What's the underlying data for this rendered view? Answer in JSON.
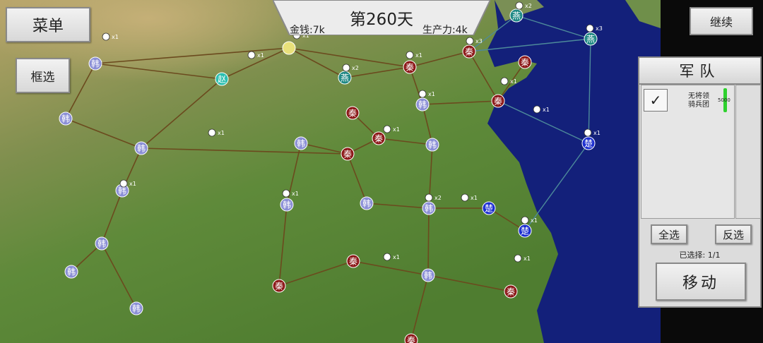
{
  "buttons": {
    "menu": "菜单",
    "box_select": "框选",
    "continue": "继续"
  },
  "banner": {
    "day": "第260天",
    "money": "金钱:7k",
    "production": "生产力:4k"
  },
  "army_panel": {
    "title": "军队",
    "unit": {
      "general": "无将领",
      "type": "骑兵团",
      "count": "5000",
      "checked": "✓"
    },
    "select_all": "全选",
    "invert": "反选",
    "selected": "已选择: 1/1",
    "move": "移动"
  },
  "colors": {
    "qin": "#8c1818",
    "han": "#8b8fd6",
    "zhao": "#2bbfb0",
    "yan": "#1e8884",
    "chu": "#1d2fd0",
    "neutral": "#e8e07a",
    "road": "#6b4a1e",
    "sea": "#13207a"
  },
  "map": {
    "cities": [
      {
        "name": "韩",
        "faction": "han"
      },
      {
        "name": "韩",
        "faction": "han"
      },
      {
        "name": "韩",
        "faction": "han"
      },
      {
        "name": "韩",
        "faction": "han"
      },
      {
        "name": "韩",
        "faction": "han"
      },
      {
        "name": "韩",
        "faction": "han"
      },
      {
        "name": "韩",
        "faction": "han"
      },
      {
        "name": "韩",
        "faction": "han"
      },
      {
        "name": "韩",
        "faction": "han"
      },
      {
        "name": "韩",
        "faction": "han"
      },
      {
        "name": "韩",
        "faction": "han"
      },
      {
        "name": "韩",
        "faction": "han"
      },
      {
        "name": "韩",
        "faction": "han"
      },
      {
        "name": "韩",
        "faction": "han"
      },
      {
        "name": "赵",
        "faction": "zhao"
      },
      {
        "name": "燕",
        "faction": "yan"
      },
      {
        "name": "燕",
        "faction": "yan"
      },
      {
        "name": "燕",
        "faction": "yan"
      },
      {
        "name": "秦",
        "faction": "qin"
      },
      {
        "name": "秦",
        "faction": "qin"
      },
      {
        "name": "秦",
        "faction": "qin"
      },
      {
        "name": "秦",
        "faction": "qin"
      },
      {
        "name": "秦",
        "faction": "qin"
      },
      {
        "name": "秦",
        "faction": "qin"
      },
      {
        "name": "秦",
        "faction": "qin"
      },
      {
        "name": "秦",
        "faction": "qin"
      },
      {
        "name": "秦",
        "faction": "qin"
      },
      {
        "name": "秦",
        "faction": "qin"
      },
      {
        "name": "秦",
        "faction": "qin"
      },
      {
        "name": "楚",
        "faction": "chu"
      },
      {
        "name": "楚",
        "faction": "chu"
      },
      {
        "name": "楚",
        "faction": "chu"
      },
      {
        "name": "",
        "faction": "neutral"
      }
    ],
    "troop_labels": [
      "x1",
      "x1",
      "x1",
      "x1",
      "x1",
      "x1",
      "x2",
      "x2",
      "x3",
      "x3",
      "x1",
      "x1",
      "x1",
      "x1",
      "x1",
      "x1",
      "x2",
      "x1",
      "x1",
      "x1",
      "x1"
    ]
  }
}
